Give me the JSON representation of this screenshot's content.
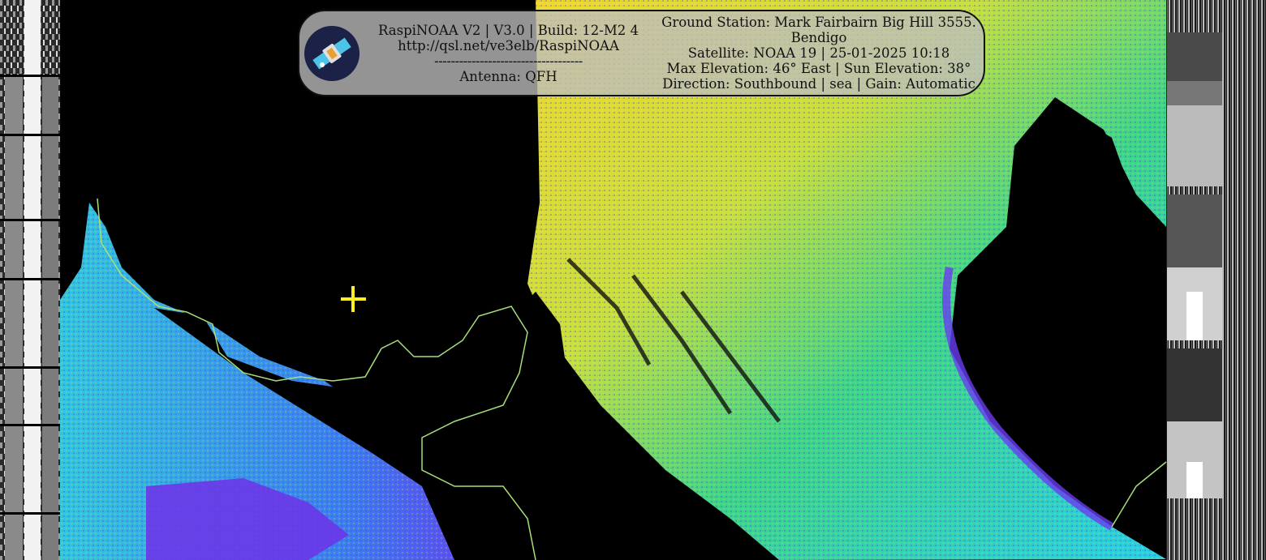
{
  "overlay": {
    "app_line": "RaspiNOAA V2 | V3.0 | Build: 12-M2 4",
    "url": "http://qsl.net/ve3elb/RaspiNOAA",
    "separator": "------------------------------------",
    "antenna": "Antenna: QFH",
    "ground_station": "Ground Station: Mark Fairbairn Big Hill 3555. Bendigo",
    "satellite": "Satellite: NOAA 19 | 25-01-2025 10:18",
    "elevation": "Max Elevation: 46° East | Sun Elevation: 38°",
    "direction": "Direction: Southbound | sea | Gain: Automatic"
  },
  "logo": {
    "icon": "satellite-icon"
  },
  "image": {
    "type": "NOAA APT satellite weather image, false-colour sea surface temperature",
    "marker": "crosshair-icon",
    "colors": {
      "background": "#000000",
      "coastline": "#a6e07a",
      "marker": "#ffee22",
      "cold": "#7a3cff",
      "cool": "#2fd4e8",
      "mild": "#3bd67a",
      "warm": "#e8e038",
      "hot": "#e04020"
    }
  }
}
